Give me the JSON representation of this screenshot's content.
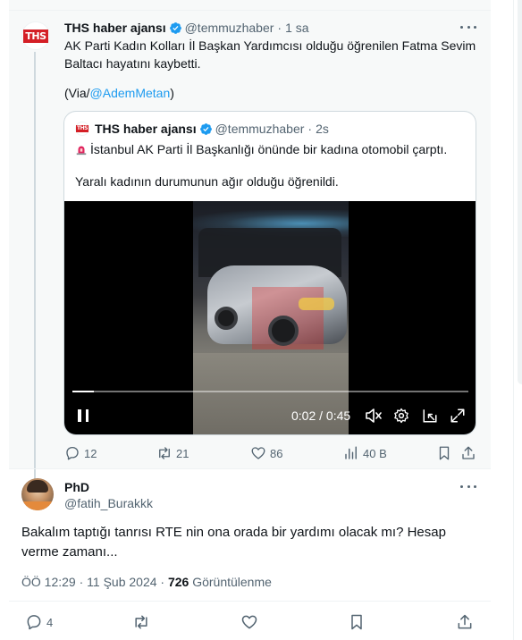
{
  "main_tweet": {
    "author_name": "THS haber ajansı",
    "handle": "@temmuzhaber",
    "time": "1 sa",
    "text": "AK Parti Kadın Kolları İl Başkan Yardımcısı olduğu öğrenilen Fatma Sevim Baltacı hayatını kaybetti.",
    "via_prefix": "(Via/",
    "via_link": "@AdemMetan",
    "via_suffix": ")",
    "avatar_logo": "THS",
    "stats": {
      "replies": "12",
      "retweets": "21",
      "likes": "86",
      "views": "40 B"
    }
  },
  "quoted_tweet": {
    "author_name": "THS haber ajansı",
    "handle": "@temmuzhaber",
    "time": "2s",
    "line1": "İstanbul AK Parti İl Başkanlığı önünde bir kadına otomobil çarptı.",
    "line2": "Yaralı kadının durumunun ağır olduğu öğrenildi.",
    "avatar_logo": "THS",
    "video": {
      "time_display": "0:02 / 0:45",
      "progress": 0.035
    }
  },
  "reply_tweet": {
    "author_name": "PhD",
    "handle": "@fatih_Burakkk",
    "text": "Bakalım taptığı tanrısı RTE nin ona orada bir yardımı olacak mı? Hesap verme zamanı...",
    "timestamp": "ÖÖ 12:29 · 11 Şub 2024 · ",
    "views_count": "726",
    "views_label": " Görüntülenme",
    "stats": {
      "replies": "4"
    }
  },
  "colors": {
    "accent": "#1d9bf0",
    "muted": "#536471",
    "text": "#0f1419",
    "logo_red": "#d41f26"
  },
  "icons": [
    "verified-icon",
    "more-icon",
    "siren-icon",
    "reply-icon",
    "retweet-icon",
    "like-icon",
    "views-icon",
    "bookmark-icon",
    "share-icon",
    "pause-icon",
    "mute-icon",
    "settings-icon",
    "pip-icon",
    "fullscreen-icon"
  ]
}
